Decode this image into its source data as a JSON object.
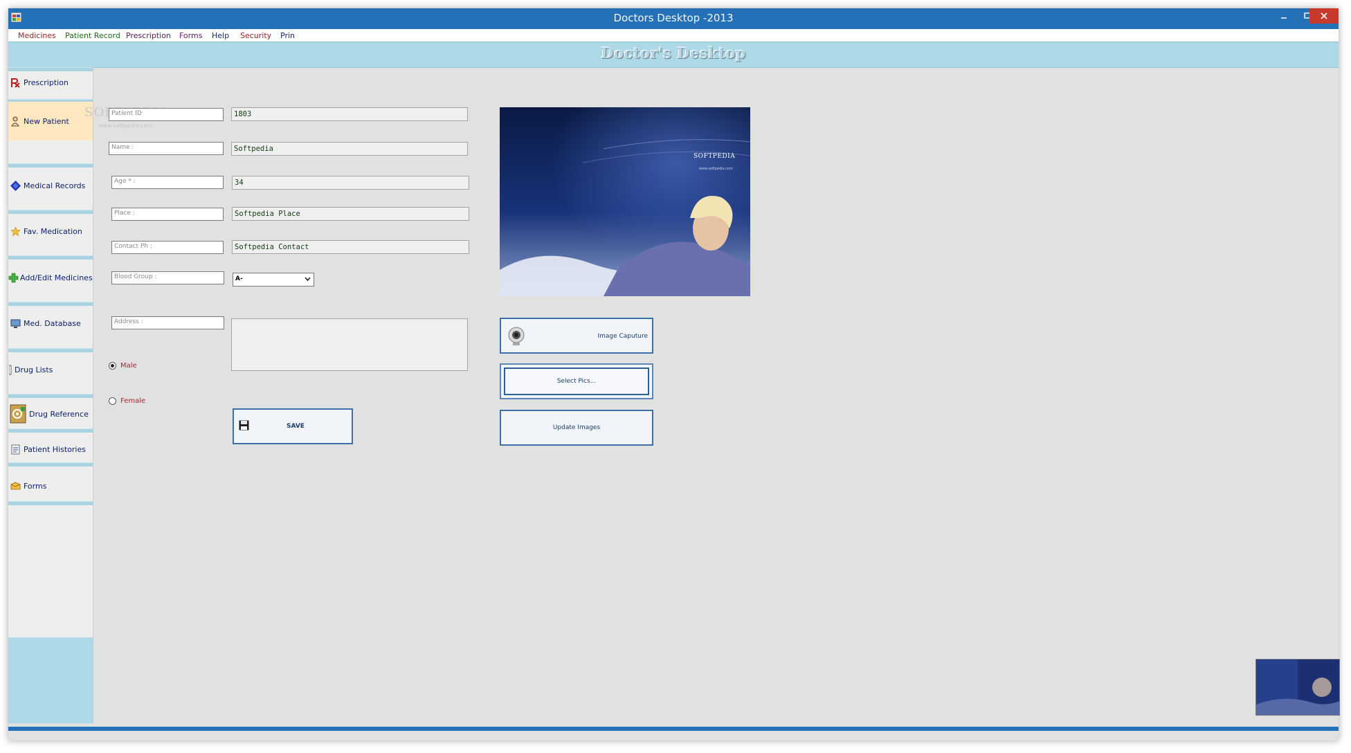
{
  "window": {
    "title": "Doctors Desktop -2013"
  },
  "menu": [
    "Medicines",
    "Patient Record",
    "Prescription",
    "Forms",
    "Help",
    "Security",
    "Prin"
  ],
  "banner": {
    "title": "Doctor's Desktop"
  },
  "sidebar": {
    "items": [
      {
        "label": "Prescription",
        "icon": "prescription-icon"
      },
      {
        "label": "New Patient",
        "icon": "new-patient-icon",
        "active": true
      },
      {
        "label": "Medical Records",
        "icon": "medical-records-icon"
      },
      {
        "label": "Fav. Medication",
        "icon": "star-icon"
      },
      {
        "label": "Add/Edit  Medicines",
        "icon": "plus-icon"
      },
      {
        "label": "Med. Database",
        "icon": "computer-icon"
      },
      {
        "label": "Drug Lists",
        "icon": "list-icon"
      },
      {
        "label": "Drug Reference",
        "icon": "reference-icon"
      },
      {
        "label": "Patient Histories",
        "icon": "histories-icon"
      },
      {
        "label": "Forms",
        "icon": "forms-icon"
      }
    ]
  },
  "watermark": {
    "text": "SOFTPEDIA",
    "sub": "www.softpedia.com"
  },
  "form": {
    "patient_id": {
      "label": "Patient ID",
      "value": "1803"
    },
    "name": {
      "label": "Name :",
      "value": "Softpedia"
    },
    "age": {
      "label": "Age * :",
      "value": "34"
    },
    "place": {
      "label": "Place :",
      "value": "Softpedia Place"
    },
    "contact": {
      "label": "Contact Ph :",
      "value": "Softpedia Contact"
    },
    "blood_group": {
      "label": "Blood Group :",
      "value": "A-"
    },
    "address": {
      "label": "Address  :",
      "value": ""
    },
    "gender": {
      "male": "Male",
      "female": "Female",
      "selected": "Male"
    }
  },
  "buttons": {
    "save": "SAVE",
    "image_capture": "Image Caputure",
    "select_pics": "Select Pics...",
    "update_images": "Update Images"
  },
  "photo": {
    "brand": "SOFTPEDIA",
    "url": "www.softpedia.com"
  },
  "colors": {
    "titlebar": "#2571b8",
    "banner": "#add8e6",
    "sidebar_active": "#fde8bf",
    "close": "#c7392b"
  }
}
